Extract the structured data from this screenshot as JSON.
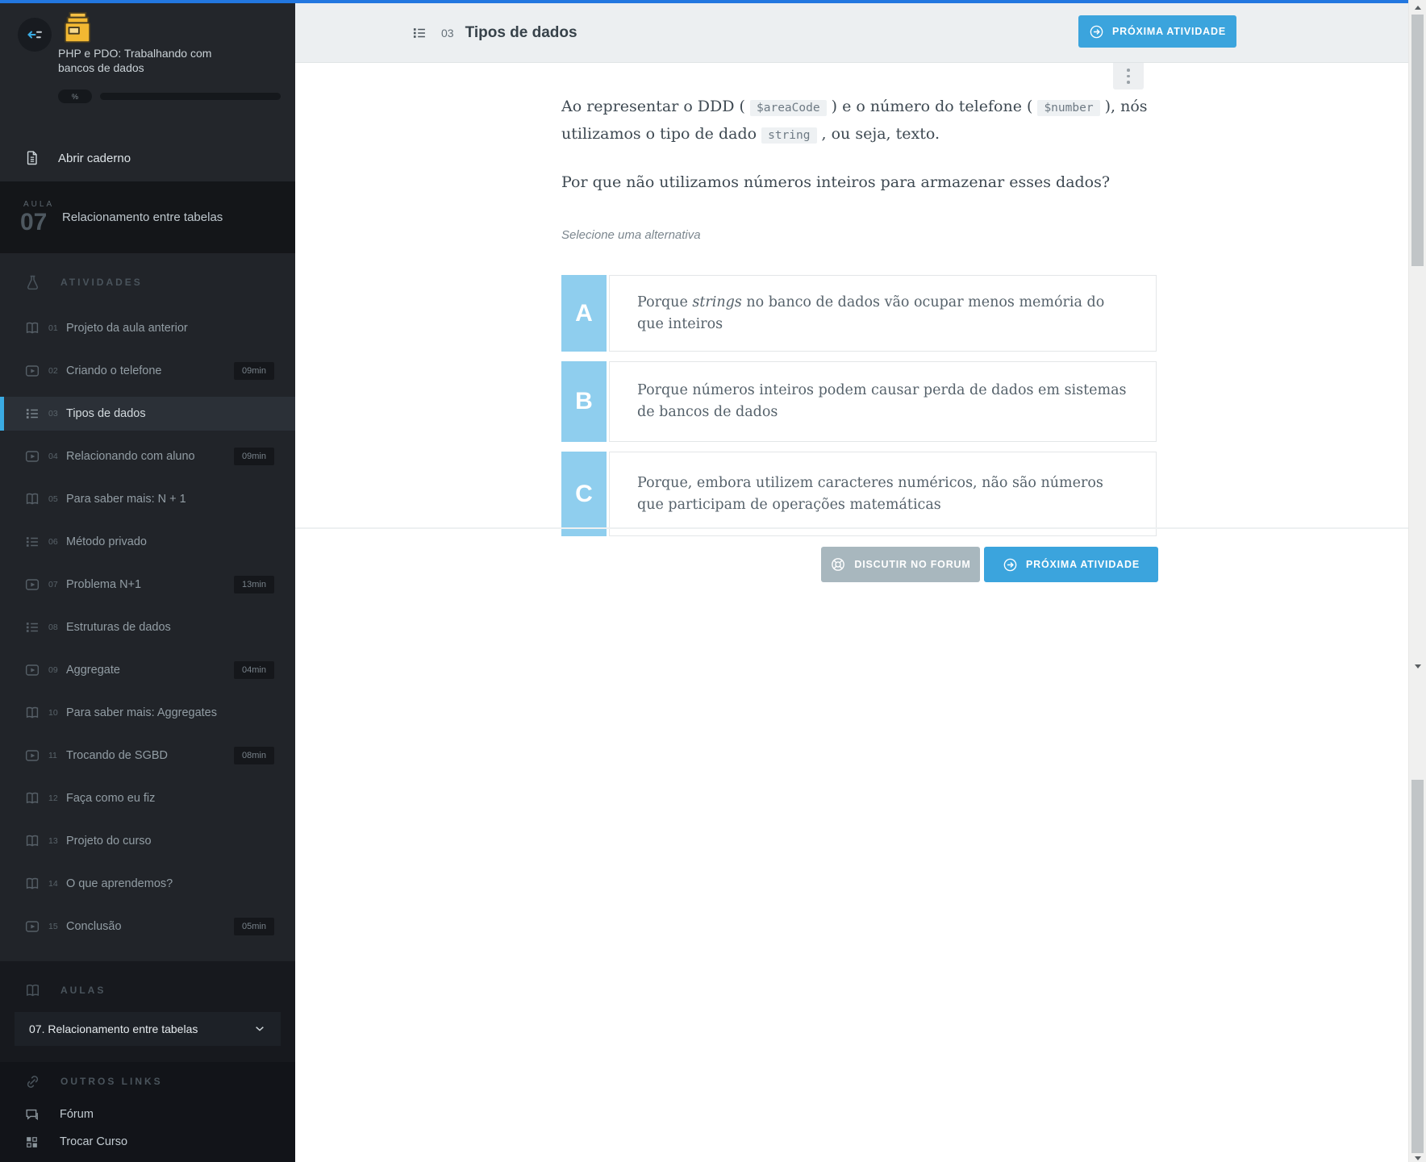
{
  "colors": {
    "top_line": "#2277e0",
    "accent_blue": "#3ba4dd",
    "active_item_bar": "#3aabe3",
    "option_letter_bg": "#8fceee",
    "gray_button": "#a8b7be",
    "sidebar_bg": "#23262b",
    "header_bg": "#eceff1"
  },
  "sidebar": {
    "course_title": "PHP e PDO: Trabalhando com bancos de dados",
    "progress_label": "%",
    "notebook_label": "Abrir caderno",
    "lesson_banner": {
      "kicker": "AULA",
      "number": "07",
      "title": "Relacionamento entre tabelas"
    },
    "activities_header": "ATIVIDADES",
    "activities": [
      {
        "num": "01",
        "label": "Projeto da aula anterior",
        "duration": ""
      },
      {
        "num": "02",
        "label": "Criando o telefone",
        "duration": "09min"
      },
      {
        "num": "03",
        "label": "Tipos de dados",
        "duration": ""
      },
      {
        "num": "04",
        "label": "Relacionando com aluno",
        "duration": "09min"
      },
      {
        "num": "05",
        "label": "Para saber mais: N + 1",
        "duration": ""
      },
      {
        "num": "06",
        "label": "Método privado",
        "duration": ""
      },
      {
        "num": "07",
        "label": "Problema N+1",
        "duration": "13min"
      },
      {
        "num": "08",
        "label": "Estruturas de dados",
        "duration": ""
      },
      {
        "num": "09",
        "label": "Aggregate",
        "duration": "04min"
      },
      {
        "num": "10",
        "label": "Para saber mais: Aggregates",
        "duration": ""
      },
      {
        "num": "11",
        "label": "Trocando de SGBD",
        "duration": "08min"
      },
      {
        "num": "12",
        "label": "Faça como eu fiz",
        "duration": ""
      },
      {
        "num": "13",
        "label": "Projeto do curso",
        "duration": ""
      },
      {
        "num": "14",
        "label": "O que aprendemos?",
        "duration": ""
      },
      {
        "num": "15",
        "label": "Conclusão",
        "duration": "05min"
      }
    ],
    "aulas_header": "AULAS",
    "lesson_select_value": "07. Relacionamento entre tabelas",
    "other_links_header": "OUTROS LINKS",
    "other_links": [
      {
        "label": "Fórum"
      },
      {
        "label": "Trocar Curso"
      }
    ]
  },
  "header": {
    "activity_number": "03",
    "title": "Tipos de dados",
    "next_button_label": "PRÓXIMA ATIVIDADE"
  },
  "question": {
    "intro_segments": [
      {
        "t": "text",
        "v": "Ao representar o DDD ( "
      },
      {
        "t": "code",
        "v": "$areaCode"
      },
      {
        "t": "text",
        "v": " ) e o número do telefone ( "
      },
      {
        "t": "code",
        "v": "$number"
      },
      {
        "t": "text",
        "v": " ), nós utilizamos o tipo de dado "
      },
      {
        "t": "code",
        "v": "string"
      },
      {
        "t": "text",
        "v": " , ou seja, texto."
      }
    ],
    "prompt": "Por que não utilizamos números inteiros para armazenar esses dados?",
    "select_hint": "Selecione uma alternativa",
    "options": [
      {
        "letter": "A",
        "text_segments": [
          {
            "t": "text",
            "v": "Porque "
          },
          {
            "t": "em",
            "v": "strings"
          },
          {
            "t": "text",
            "v": " no banco de dados vão ocupar menos memória do que inteiros"
          }
        ]
      },
      {
        "letter": "B",
        "text_segments": [
          {
            "t": "text",
            "v": "Porque números inteiros podem causar perda de dados em sistemas de bancos de dados"
          }
        ]
      },
      {
        "letter": "C",
        "text_segments": [
          {
            "t": "text",
            "v": "Porque, embora utilizem caracteres numéricos, não são números que participam de operações matemáticas"
          }
        ]
      }
    ],
    "forum_button_label": "DISCUTIR NO FORUM",
    "next_button_label": "PRÓXIMA ATIVIDADE"
  }
}
